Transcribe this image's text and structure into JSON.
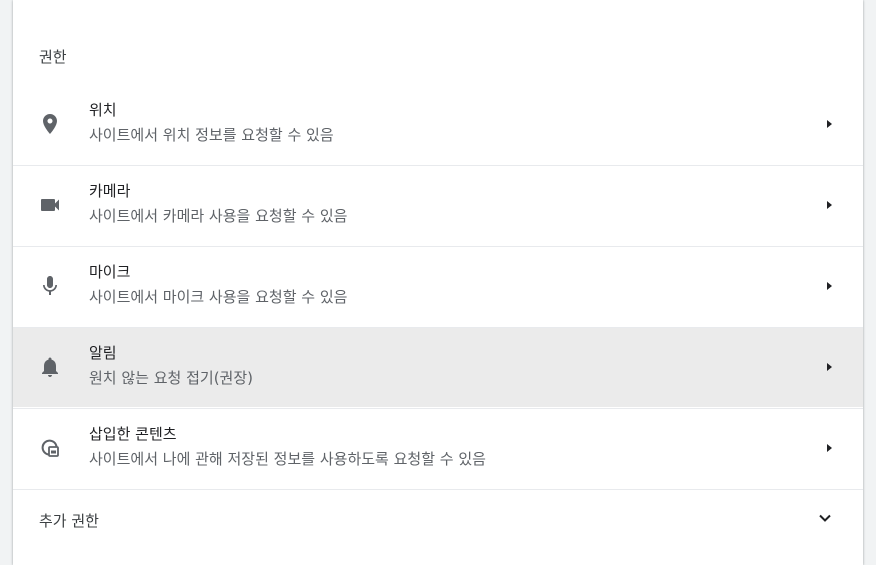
{
  "section_title": "권한",
  "permissions": [
    {
      "title": "위치",
      "description": "사이트에서 위치 정보를 요청할 수 있음",
      "icon": "location-pin-icon"
    },
    {
      "title": "카메라",
      "description": "사이트에서 카메라 사용을 요청할 수 있음",
      "icon": "videocam-icon"
    },
    {
      "title": "마이크",
      "description": "사이트에서 마이크 사용을 요청할 수 있음",
      "icon": "mic-icon"
    },
    {
      "title": "알림",
      "description": "원치 않는 요청 접기(권장)",
      "icon": "bell-icon",
      "highlighted": true
    },
    {
      "title": "삽입한 콘텐츠",
      "description": "사이트에서 나에 관해 저장된 정보를 사용하도록 요청할 수 있음",
      "icon": "embedded-content-icon"
    }
  ],
  "more_permissions_label": "추가 권한",
  "colors": {
    "icon": "#5f6368",
    "highlight_bg": "#ebebeb",
    "divider": "#e8eaed"
  }
}
